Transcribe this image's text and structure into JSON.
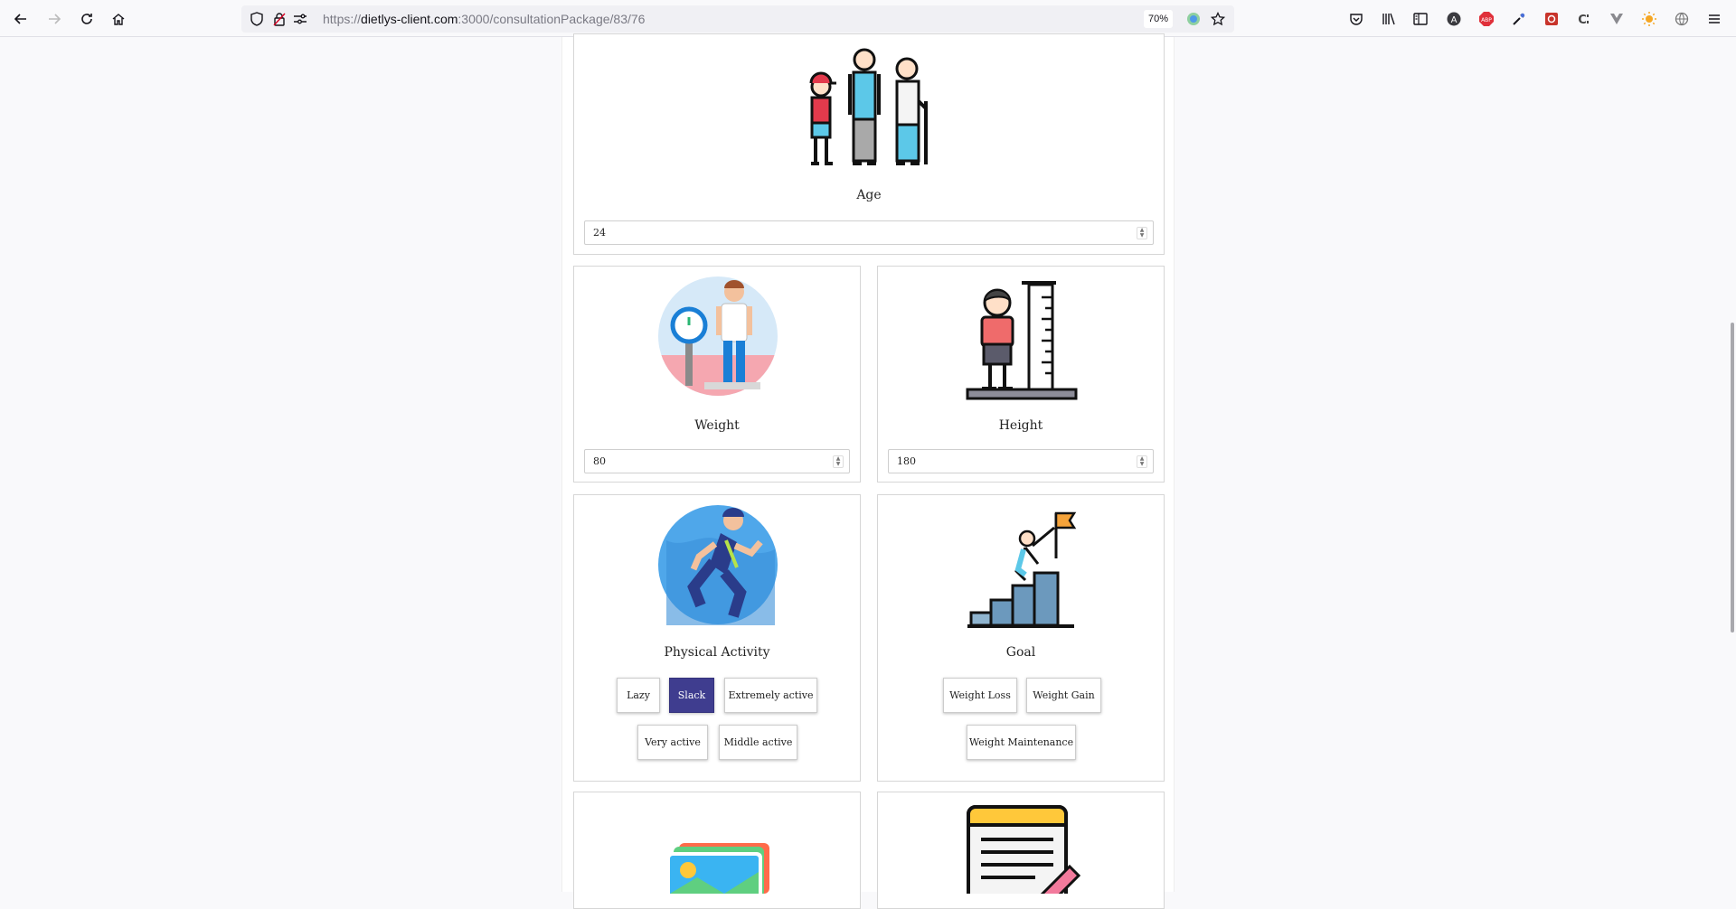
{
  "browser": {
    "url_prefix": "https://",
    "url_host": "dietlys-client.com",
    "url_path": ":3000/consultationPackage/83/76",
    "zoom": "70%"
  },
  "age": {
    "title": "Age",
    "value": "24"
  },
  "weight": {
    "title": "Weight",
    "value": "80"
  },
  "height": {
    "title": "Height",
    "value": "180"
  },
  "activity": {
    "title": "Physical Activity",
    "options": [
      "Lazy",
      "Slack",
      "Extremely active",
      "Very active",
      "Middle active"
    ],
    "selected": "Slack"
  },
  "goal": {
    "title": "Goal",
    "options": [
      "Weight Loss",
      "Weight Gain",
      "Weight Maintenance"
    ]
  },
  "colors": {
    "accent": "#3f3d8f",
    "card_border": "#d6d6d6"
  }
}
